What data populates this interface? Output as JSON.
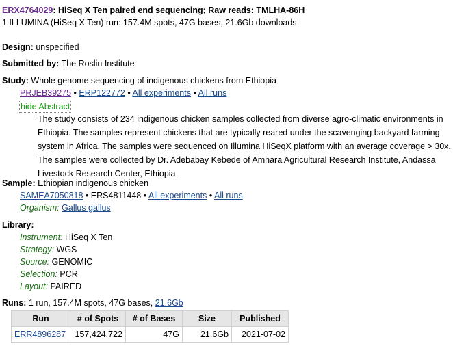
{
  "header": {
    "experiment_id": "ERX4764029",
    "title_rest": ": HiSeq X Ten paired end sequencing; Raw reads: TMLHA-86H",
    "summary": "1 ILLUMINA (HiSeq X Ten) run: 157.4M spots, 47G bases, 21.6Gb downloads"
  },
  "design": {
    "label": "Design:",
    "value": "unspecified"
  },
  "submitted_by": {
    "label": "Submitted by:",
    "value": "The Roslin Institute"
  },
  "study": {
    "label": "Study:",
    "value": "Whole genome sequencing of indigenous chickens from Ethiopia",
    "link1": "PRJEB39275",
    "link2": "ERP122772",
    "link3": "All experiments",
    "link4": "All runs",
    "bullet": "•",
    "hide_abstract": "hide Abstract",
    "abstract": "The study consists of 234 indigenous chicken samples collected from diverse agro-climatic environments in Ethiopia. The samples represent chickens that are typically reared under the scavenging backyard farming system in Africa. The samples were sequenced on Illumina HiSeqX platform with an average coverage > 30x. The samples were collected by Dr. Adebabay Kebede of Amhara Agricultural Research Institute, Andassa Livestock Research Center, Ethiopia"
  },
  "sample": {
    "label": "Sample:",
    "value": "Ethiopian indigenous chicken",
    "link1": "SAMEA7050818",
    "plain_id": "ERS4811448",
    "link3": "All experiments",
    "link4": "All runs",
    "organism_label": "Organism:",
    "organism": "Gallus gallus"
  },
  "library": {
    "label": "Library:",
    "fields": [
      {
        "label": "Instrument:",
        "value": "HiSeq X Ten"
      },
      {
        "label": "Strategy:",
        "value": "WGS"
      },
      {
        "label": "Source:",
        "value": "GENOMIC"
      },
      {
        "label": "Selection:",
        "value": "PCR"
      },
      {
        "label": "Layout:",
        "value": "PAIRED"
      }
    ]
  },
  "runs": {
    "label": "Runs:",
    "summary": "1 run, 157.4M spots, 47G bases,",
    "download_link": "21.6Gb",
    "columns": [
      "Run",
      "# of Spots",
      "# of Bases",
      "Size",
      "Published"
    ],
    "rows": [
      {
        "run": "ERR4896287",
        "spots": "157,424,722",
        "bases": "47G",
        "size": "21.6Gb",
        "published": "2021-07-02"
      }
    ]
  }
}
